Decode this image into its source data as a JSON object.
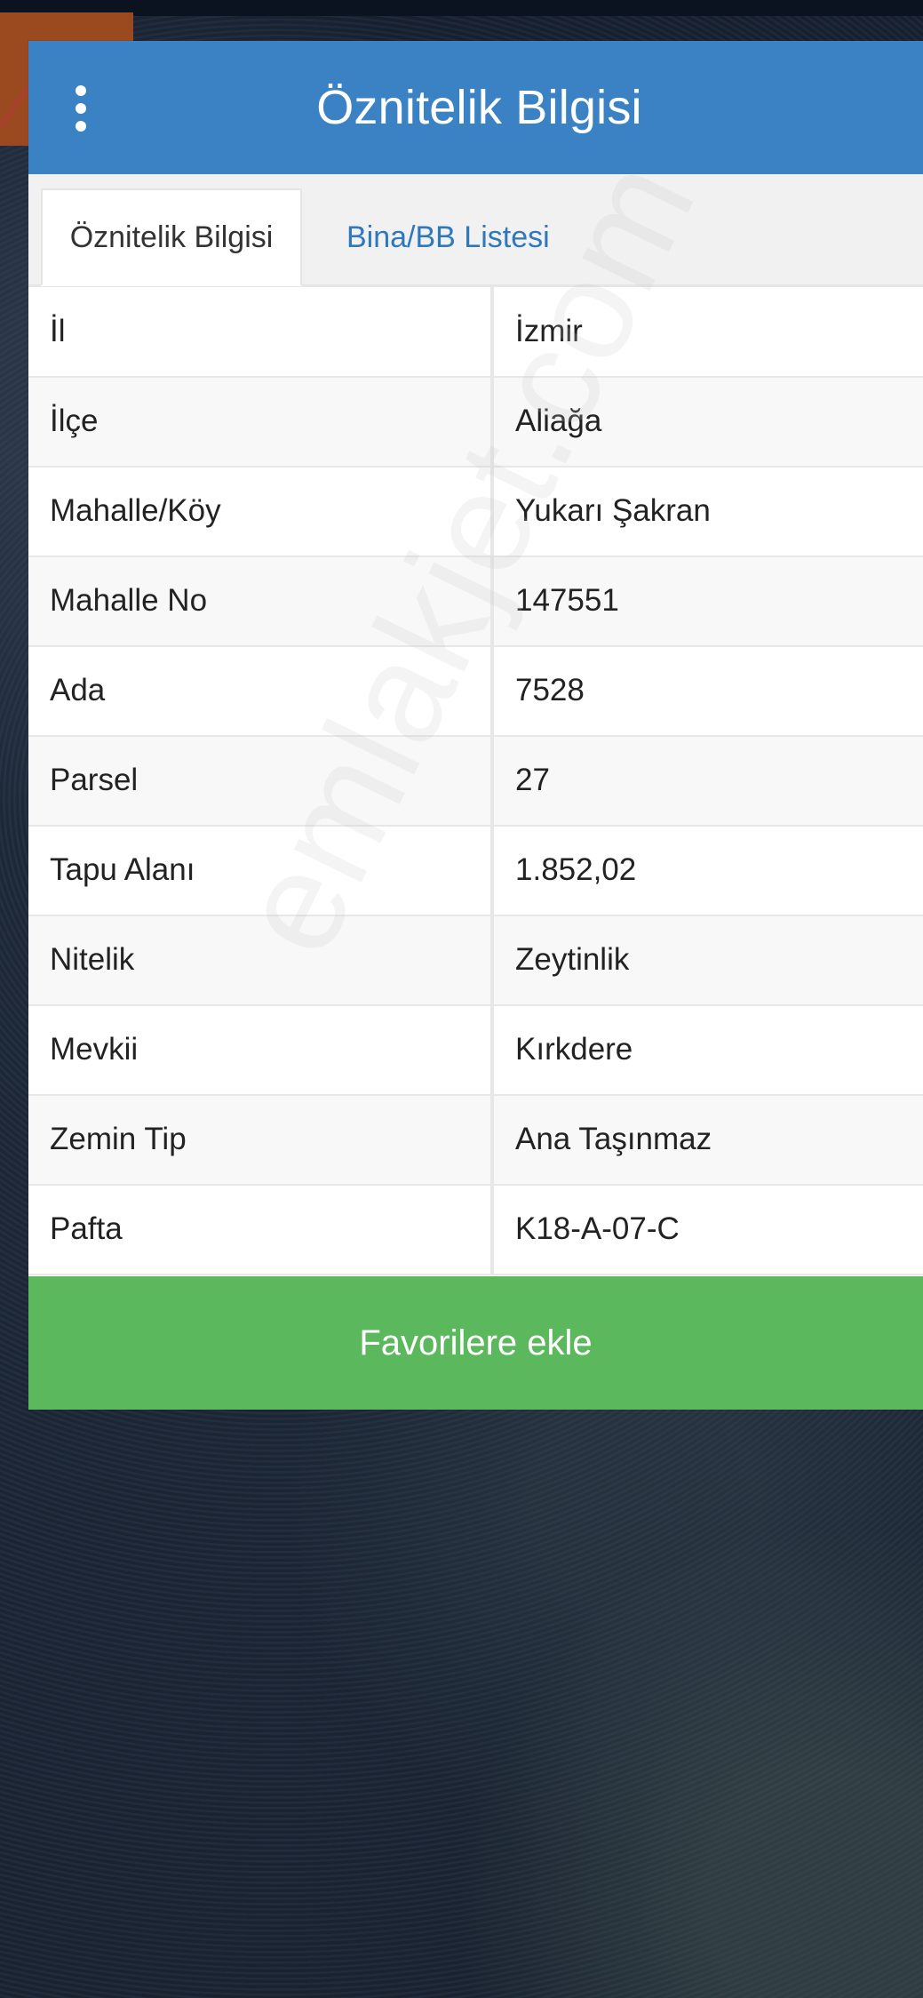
{
  "header": {
    "title": "Öznitelik Bilgisi",
    "menu_icon": "vertical-ellipsis-icon"
  },
  "tabs": [
    {
      "label": "Öznitelik Bilgisi",
      "active": true
    },
    {
      "label": "Bina/BB Listesi",
      "active": false
    }
  ],
  "rows": [
    {
      "key": "İl",
      "value": "İzmir"
    },
    {
      "key": "İlçe",
      "value": "Aliağa"
    },
    {
      "key": "Mahalle/Köy",
      "value": "Yukarı Şakran"
    },
    {
      "key": "Mahalle No",
      "value": "147551"
    },
    {
      "key": "Ada",
      "value": "7528"
    },
    {
      "key": "Parsel",
      "value": "27"
    },
    {
      "key": "Tapu Alanı",
      "value": "1.852,02"
    },
    {
      "key": "Nitelik",
      "value": "Zeytinlik"
    },
    {
      "key": "Mevkii",
      "value": "Kırkdere"
    },
    {
      "key": "Zemin Tip",
      "value": "Ana Taşınmaz"
    },
    {
      "key": "Pafta",
      "value": "K18-A-07-C"
    }
  ],
  "actions": {
    "favorite_label": "Favorilere ekle"
  },
  "watermark": "emlakjet.com",
  "colors": {
    "header_blue": "#3b82c4",
    "tab_blue": "#2f78be",
    "button_green": "#5cb85c"
  }
}
